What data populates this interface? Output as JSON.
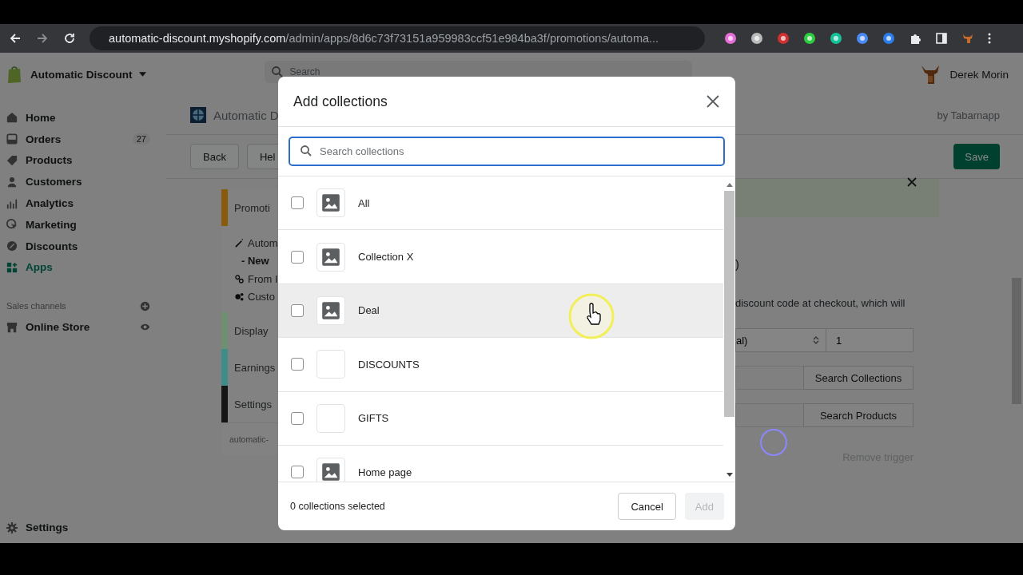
{
  "browser": {
    "url_host": "automatic-discount.myshopify.com",
    "url_path": "/admin/apps/8d6c73f73151a959983ccf51e984ba3f/promotions/automa..."
  },
  "topbar": {
    "store_name": "Automatic Discount",
    "search": {
      "placeholder": "Search"
    },
    "user_name": "Derek Morin"
  },
  "sidebar": {
    "items": [
      {
        "label": "Home",
        "selected": false
      },
      {
        "label": "Orders",
        "badge": "27",
        "selected": false
      },
      {
        "label": "Products",
        "selected": false
      },
      {
        "label": "Customers",
        "selected": false
      },
      {
        "label": "Analytics",
        "selected": false
      },
      {
        "label": "Marketing",
        "selected": false
      },
      {
        "label": "Discounts",
        "selected": false
      },
      {
        "label": "Apps",
        "selected": true
      }
    ],
    "channels_heading": "Sales channels",
    "channels": [
      {
        "label": "Online Store"
      }
    ],
    "settings": "Settings"
  },
  "app": {
    "title": "Automatic D",
    "byline": "by Tabarnapp",
    "buttons": [
      "Back",
      "Hel"
    ],
    "save": "Save",
    "nav": [
      {
        "kind": "section",
        "label": "Promoti",
        "color": "#8a5a0c"
      },
      {
        "kind": "link",
        "label": "Autom"
      },
      {
        "kind": "sub",
        "label": "- New"
      },
      {
        "kind": "link",
        "label": "From I"
      },
      {
        "kind": "link",
        "label": "Custo"
      },
      {
        "kind": "section",
        "label": "Display",
        "color": "#6e8f72"
      },
      {
        "kind": "section",
        "label": "Earnings",
        "color": "#3e8d8a"
      },
      {
        "kind": "section",
        "label": "Settings",
        "color": "#151515"
      }
    ],
    "footer": "automatic-"
  },
  "panel": {
    "heading": ")",
    "text": "discount code at checkout, which will",
    "select_value": "al)",
    "quantity": "1",
    "search_collections": "Search Collections",
    "search_products": "Search Products",
    "remove": "Remove trigger"
  },
  "modal": {
    "title": "Add collections",
    "search": {
      "placeholder": "Search collections"
    },
    "collections": [
      {
        "label": "All",
        "kind": "image",
        "checked": false,
        "hovered": false
      },
      {
        "label": "Collection X",
        "kind": "image",
        "checked": false,
        "hovered": false
      },
      {
        "label": "Deal",
        "kind": "image",
        "checked": false,
        "hovered": true
      },
      {
        "label": "DISCOUNTS",
        "kind": "empty",
        "checked": false,
        "hovered": false
      },
      {
        "label": "GIFTS",
        "kind": "empty",
        "checked": false,
        "hovered": false
      },
      {
        "label": "Home page",
        "kind": "image",
        "checked": false,
        "hovered": false
      }
    ],
    "selected_count": "0 collections selected",
    "cancel": "Cancel",
    "add": {
      "label": "Add",
      "disabled": true
    }
  }
}
